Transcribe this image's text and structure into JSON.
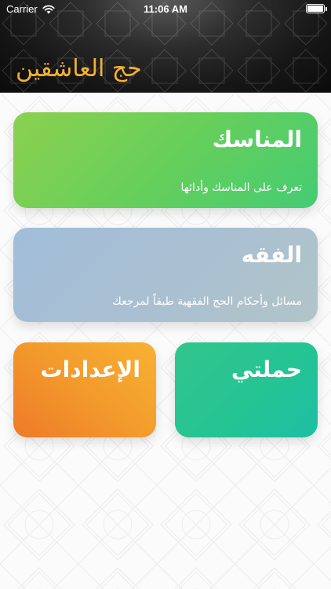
{
  "status_bar": {
    "carrier": "Carrier",
    "time": "11:06 AM"
  },
  "header": {
    "title": "حج العاشقين",
    "title_color": "#f2b233"
  },
  "cards": {
    "manasik": {
      "title": "المناسك",
      "subtitle": "تعرف على المناسك وأدائها"
    },
    "fiqh": {
      "title": "الفقه",
      "subtitle": "مسائل وأحكام الحج الفقهية طبقاً لمرجعك"
    },
    "settings": {
      "title": "الإعدادات"
    },
    "campaign": {
      "title": "حملتي"
    }
  },
  "icons": [
    "wifi-icon",
    "battery-icon"
  ]
}
